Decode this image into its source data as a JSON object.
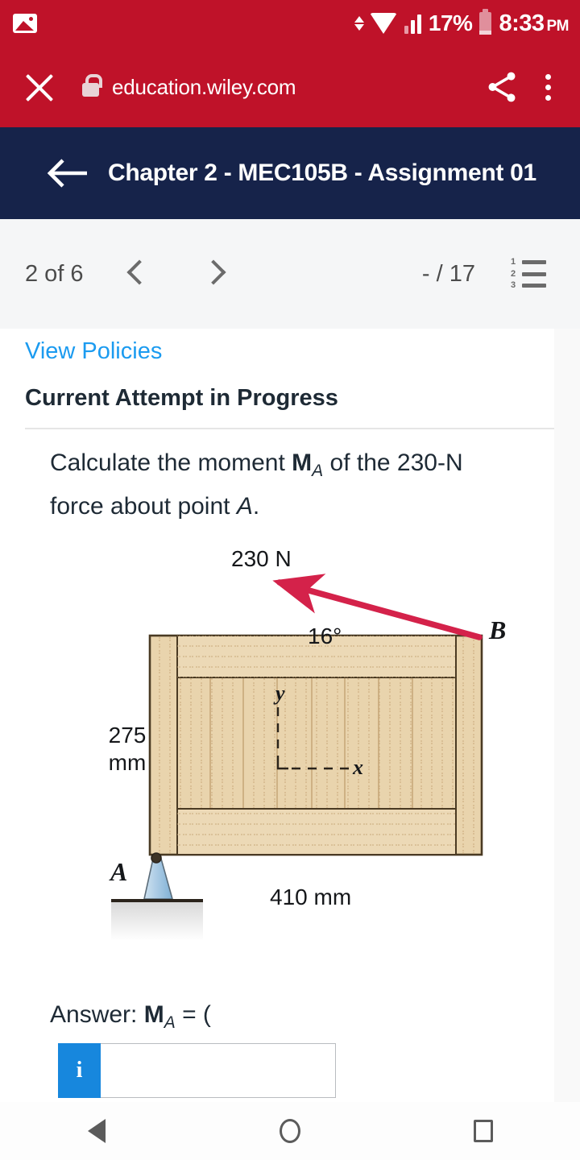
{
  "status_bar": {
    "image_icon": "image-icon",
    "data_transfer_icon": "data-transfer-arrows-icon",
    "wifi_icon": "wifi-icon",
    "signal_icon": "cell-signal-icon",
    "battery_percent": "17%",
    "battery_icon": "battery-low-icon",
    "time": "8:33",
    "meridiem": "PM"
  },
  "browser_bar": {
    "close_icon": "close-icon",
    "lock_icon": "lock-icon",
    "url": "education.wiley.com",
    "share_icon": "share-icon",
    "overflow_icon": "overflow-menu-icon",
    "background_color": "#bf1229"
  },
  "app_bar": {
    "back_icon": "back-arrow-icon",
    "title": "Chapter 2 - MEC105B - Assignment 01",
    "background_color": "#16234a"
  },
  "pager": {
    "count_label": "2 of 6",
    "prev_icon": "chevron-left-icon",
    "next_icon": "chevron-right-icon",
    "progress_label": "- / 17",
    "list_icon": "numbered-list-icon",
    "list_icon_numbers": [
      "1",
      "2",
      "3"
    ]
  },
  "content": {
    "view_policies": "View Policies",
    "attempt_status": "Current Attempt in Progress",
    "question": {
      "lead": "Calculate the moment ",
      "symbol": "M",
      "symbol_sub": "A",
      "tail_before_italic": " of the 230-N force about point ",
      "italic_point": "A",
      "period": "."
    },
    "answer": {
      "label": "Answer: ",
      "symbol": "M",
      "symbol_sub": "A",
      "equals": " = (",
      "info_icon": "info-icon",
      "info_glyph": "i",
      "input_value": "",
      "input_placeholder": ""
    }
  },
  "figure": {
    "force_label": "230 N",
    "angle_label": "16°",
    "point_b": "B",
    "point_a": "A",
    "dim_height_line1": "275",
    "dim_height_line2": "mm",
    "dim_width": "410 mm",
    "axis_y": "y",
    "axis_x": "x",
    "arrow_color": "#d4224a",
    "wood_color": "#e9d4ad",
    "support_color": "#a8c8e0",
    "description": "wooden gate pinned at A with 230 N force applied at B at 16 degrees above horizontal"
  },
  "system_nav": {
    "back_icon": "nav-back-icon",
    "home_icon": "nav-home-icon",
    "recents_icon": "nav-recents-icon"
  }
}
